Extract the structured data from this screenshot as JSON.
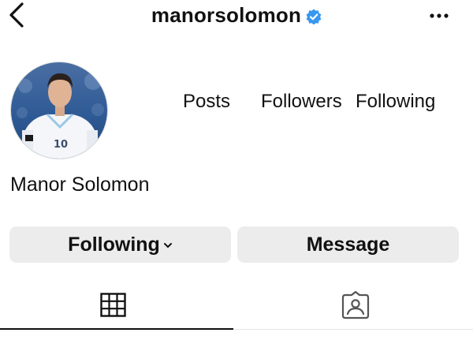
{
  "header": {
    "username": "manorsolomon",
    "back_icon": "chevron-left-icon",
    "verified_icon": "verified-badge-icon",
    "more_icon": "more-horizontal-icon",
    "verified_color": "#3897f0"
  },
  "profile": {
    "display_name": "Manor Solomon",
    "avatar_icon": "profile-avatar",
    "stats": {
      "posts_label": "Posts",
      "followers_label": "Followers",
      "following_label": "Following"
    }
  },
  "actions": {
    "following_label": "Following",
    "message_label": "Message"
  },
  "tabs": [
    {
      "icon": "grid-icon",
      "active": true
    },
    {
      "icon": "tagged-icon",
      "active": false
    }
  ]
}
